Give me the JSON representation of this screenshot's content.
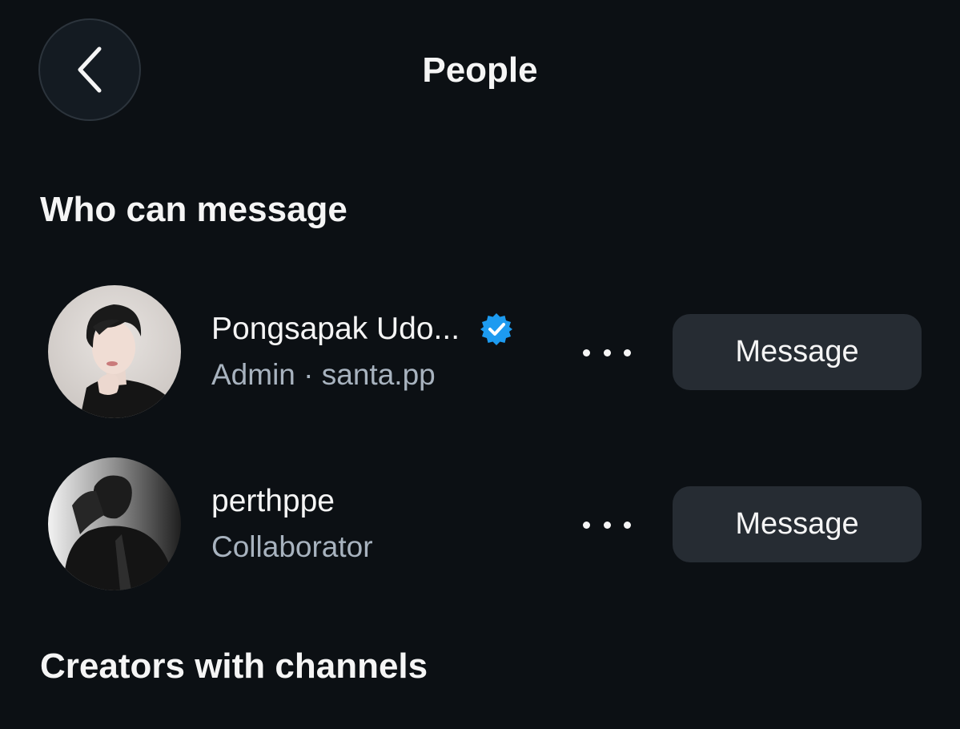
{
  "header": {
    "title": "People",
    "back_icon": "chevron-left-icon"
  },
  "sections": {
    "who_can_message": "Who can message",
    "creators_with_channels": "Creators with channels"
  },
  "people": [
    {
      "name": "Pongsapak Udo...",
      "verified": true,
      "role": "Admin",
      "separator": "·",
      "handle": "santa.pp",
      "button_label": "Message",
      "avatar_icon": "profile-photo"
    },
    {
      "name": "perthppe",
      "verified": false,
      "role": "Collaborator",
      "button_label": "Message",
      "avatar_icon": "profile-photo"
    }
  ],
  "colors": {
    "background": "#0c1014",
    "verified_badge": "#1d9bf0",
    "button_bg": "#262c33",
    "secondary_text": "#a8b3bf"
  }
}
